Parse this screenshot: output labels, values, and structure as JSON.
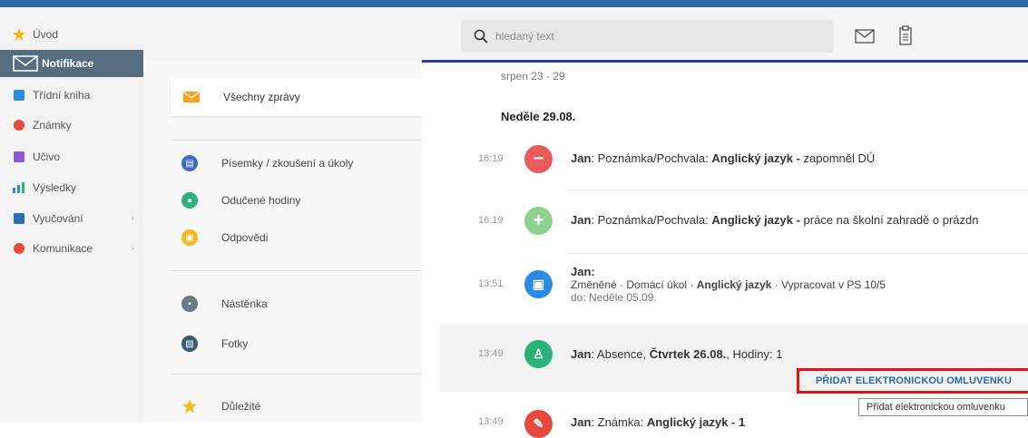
{
  "sidebar": {
    "items": [
      {
        "label": "Úvod"
      },
      {
        "label": "Notifikace"
      },
      {
        "label": "Třídní kniha"
      },
      {
        "label": "Známky"
      },
      {
        "label": "Učivo"
      },
      {
        "label": "Výsledky"
      },
      {
        "label": "Vyučování"
      },
      {
        "label": "Komunikace"
      }
    ]
  },
  "search": {
    "placeholder": "hledaný text"
  },
  "filters": {
    "all_messages": "Všechny zprávy",
    "items": [
      {
        "label": "Písemky / zkoušení a úkoly"
      },
      {
        "label": "Odučené hodiny"
      },
      {
        "label": "Odpovědi"
      },
      {
        "label": "Nástěnka"
      },
      {
        "label": "Fotky"
      },
      {
        "label": "Důležité"
      }
    ]
  },
  "feed": {
    "week": "srpen 23 - 29",
    "day": "Neděle 29.08.",
    "messages": [
      {
        "time": "16:19",
        "author": "Jan",
        "type": ": Poznámka/Pochvala: ",
        "subject": "Anglický jazyk - ",
        "body": "zapomněl DÚ"
      },
      {
        "time": "16:19",
        "author": "Jan",
        "type": ": Poznámka/Pochvala: ",
        "subject": "Anglický jazyk - ",
        "body": "práce na školní zahradě o prázdn"
      },
      {
        "time": "13:51",
        "author": "Jan",
        "colon": ":",
        "line2a": "Změněné · Domácí úkol · ",
        "subject": "Anglický jazyk",
        "line2b": " · Vypracovat v PS 10/5",
        "line3": "do: Neděle 05.09."
      },
      {
        "time": "13:49",
        "author": "Jan",
        "type": ": Absence, ",
        "subject": "Čtvrtek 26.08.",
        "body": ", Hodiny: 1"
      },
      {
        "time": "13:49",
        "author": "Jan",
        "type": ": Známka: ",
        "subject": "Anglický jazyk - 1"
      }
    ],
    "excuse_button": "PŘIDAT ELEKTRONICKOU OMLUVENKU",
    "tooltip": "Přidat elektronickou omluvenku"
  },
  "colors": {
    "accent_blue": "#2c6aa6",
    "remark_red": "#e85b5b",
    "praise_green": "#8fd18f",
    "homework_blue": "#2a8be0",
    "absence_green": "#2ab27b",
    "highlight_red": "#e2121b"
  }
}
